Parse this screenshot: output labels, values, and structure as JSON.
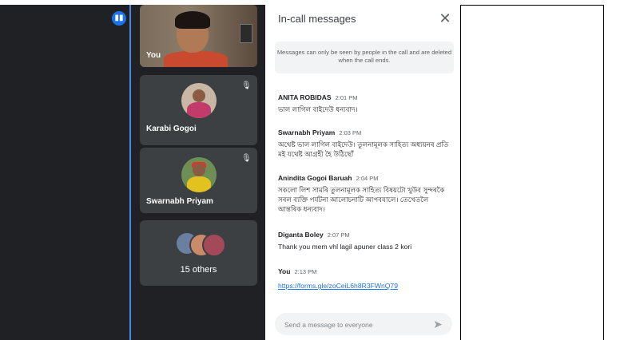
{
  "panel": {
    "title": "In-call messages",
    "close_icon": "close-icon",
    "notice": "Messages can only be seen by people in the call and are deleted when the call ends.",
    "compose_placeholder": "Send a message to everyone",
    "send_icon": "send-icon"
  },
  "messages": [
    {
      "sender": "ANITA ROBIDAS",
      "time": "2:01 PM",
      "text": "ভাল লাগিল বাইদেউ ধন্যবাদ।"
    },
    {
      "sender": "Swarnabh Priyam",
      "time": "2:03 PM",
      "text": "অথেষ্ট ভাল লাগিল বাইদেউ। তুলনামূলক সাহিত্য অধ্যয়নৰ প্ৰতি মই যথেষ্ট আগ্ৰহী হৈ উঠিছোঁ"
    },
    {
      "sender": "Anindita Gogoi Baruah",
      "time": "2:04 PM",
      "text": "সকলো লিশ সামৰি তুলনামূলক সাহিত্য বিষয়টো খুউব সুন্দৰকৈ সৰল ব্যক্তি পৰ্যটনা আলোচনাটি আপবযালে। তেখেতলৈ আন্তৰিক ধন্যবাদ।"
    },
    {
      "sender": "Diganta Boley",
      "time": "2:07 PM",
      "text": "Thank you mem vhl lagil apuner class 2 kori"
    },
    {
      "sender": "You",
      "time": "2:13 PM",
      "link": "https://forms.gle/zoCeiL6h8R3FWnQ79"
    }
  ],
  "participants": {
    "self_label": "You",
    "tiles": [
      {
        "name": "Karabi Gogoi"
      },
      {
        "name": "Swarnabh Priyam"
      }
    ],
    "others_label": "15 others"
  },
  "colors": {
    "accent": "#1a73e8",
    "dark_bg": "#202124",
    "tile_bg": "#3c4043"
  }
}
